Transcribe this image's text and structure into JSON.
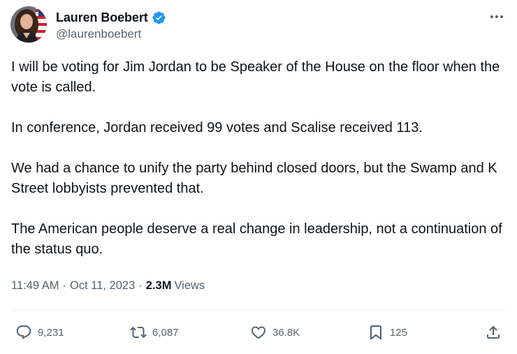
{
  "author": {
    "display_name": "Lauren Boebert",
    "handle": "@laurenboebert",
    "verified": true
  },
  "tweet": {
    "paragraphs": [
      "I will be voting for Jim Jordan to be Speaker of the House on the floor when the vote is called.",
      "In conference, Jordan received 99 votes and Scalise received 113.",
      "We had a chance to unify the party behind closed doors, but the Swamp and K Street lobbyists prevented that.",
      "The American people deserve a real change in leadership, not a continuation of the status quo."
    ],
    "time": "11:49 AM",
    "separator": "·",
    "date": "Oct 11, 2023",
    "views_count": "2.3M",
    "views_label": "Views"
  },
  "actions": {
    "replies": "9,231",
    "reposts": "6,087",
    "likes": "36.8K",
    "bookmarks": "125"
  },
  "icons": {
    "verified": "verified-badge-icon",
    "more": "more-horizontal-icon",
    "reply": "reply-bubble-icon",
    "repost": "repost-arrows-icon",
    "like": "heart-icon",
    "bookmark": "bookmark-icon",
    "share": "share-upload-icon"
  },
  "colors": {
    "text_primary": "#0f1419",
    "text_secondary": "#536471",
    "verified_blue": "#1d9bf0",
    "divider": "#eff3f4"
  }
}
